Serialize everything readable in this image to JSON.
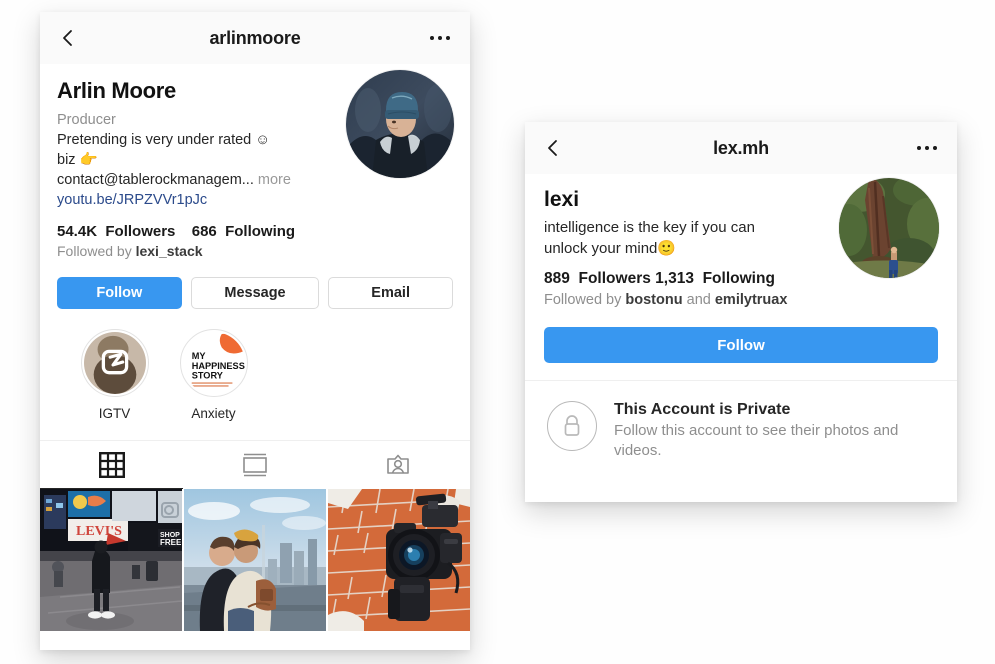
{
  "theme": {
    "accent_blue": "#3897f0",
    "link_blue": "#2b4a8b",
    "text_primary": "#262626",
    "text_muted": "#8e8e8e",
    "border": "#dbdbdb",
    "page_background": "#fefefe",
    "card_background": "#ffffff"
  },
  "left_profile": {
    "navbar": {
      "back_icon": "chevron-left-icon",
      "title": "arlinmoore",
      "options_icon": "ellipsis-icon"
    },
    "avatar": {
      "icon": "avatar",
      "alt": "man in blue knit beanie and dark winter coat"
    },
    "full_name": "Arlin Moore",
    "category": "Producer",
    "bio_lines": [
      "Pretending is very under rated ☺",
      "biz 👉",
      "contact@tablerockmanagem..."
    ],
    "more_label": "more",
    "website": "youtu.be/JRPZVVr1pJc",
    "stats": {
      "followers_count": "54.4K",
      "followers_label": "Followers",
      "following_count": "686",
      "following_label": "Following"
    },
    "followed_by": {
      "prefix": "Followed by",
      "names": "lexi_stack"
    },
    "buttons": {
      "follow": "Follow",
      "message": "Message",
      "email": "Email"
    },
    "highlights": [
      {
        "label": "IGTV",
        "icon": "igtv-icon",
        "alt": "IGTV television glyph over portrait"
      },
      {
        "label": "Anxiety",
        "icon": "book-cover",
        "alt": "MY HAPPINESS STORY book cover",
        "cover_lines": [
          "MY",
          "HAPPINESS",
          "STORY"
        ]
      }
    ],
    "tabs": [
      {
        "name": "grid",
        "icon": "grid-icon",
        "active": true
      },
      {
        "name": "feed",
        "icon": "feed-list-icon",
        "active": false
      },
      {
        "name": "tagged",
        "icon": "tagged-person-icon",
        "active": false
      }
    ],
    "grid_posts": [
      {
        "alt": "Times Square at night with Levi's billboard"
      },
      {
        "alt": "couple embracing at city observation deck"
      },
      {
        "alt": "black video camera against orange brick wall"
      }
    ]
  },
  "right_profile": {
    "navbar": {
      "back_icon": "chevron-left-icon",
      "title": "lex.mh",
      "options_icon": "ellipsis-icon"
    },
    "avatar": {
      "icon": "avatar",
      "alt": "person standing beside a giant redwood tree"
    },
    "full_name": "lexi",
    "bio": "intelligence is the key if you can unlock your mind🙂",
    "stats": {
      "followers_count": "889",
      "followers_label": "Followers",
      "following_count": "1,313",
      "following_label": "Following"
    },
    "followed_by": {
      "prefix": "Followed by",
      "name_one": "bostonu",
      "conjunction": "and",
      "name_two": "emilytruax"
    },
    "buttons": {
      "follow": "Follow"
    },
    "private_notice": {
      "icon": "lock-icon",
      "title": "This Account is Private",
      "subtitle": "Follow this account to see their photos and videos."
    }
  }
}
